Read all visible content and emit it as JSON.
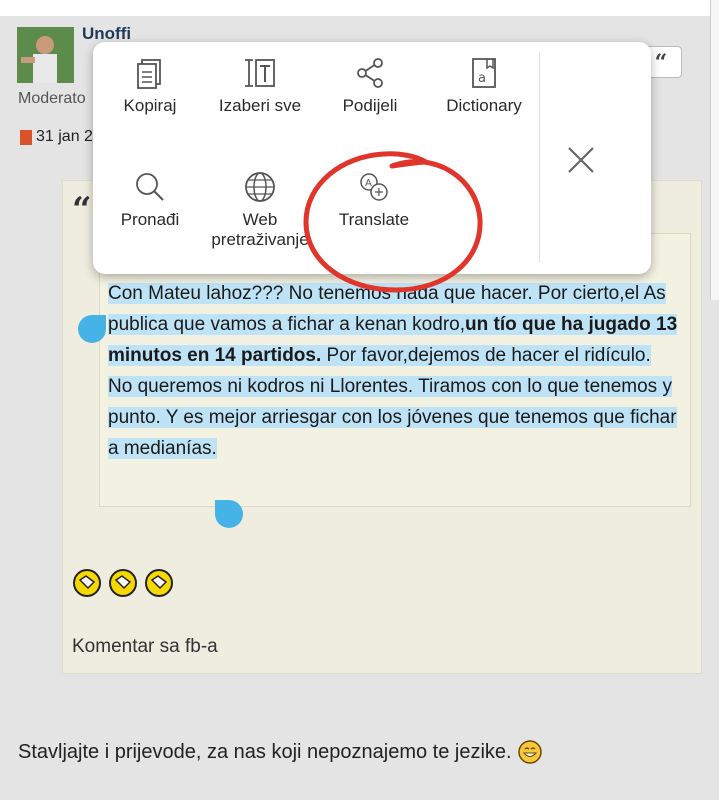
{
  "post": {
    "username": "Unoffi",
    "role": "Moderato",
    "date": "31 jan 2",
    "quote_mark": "“",
    "quote_text_1": "Con Mateu lahoz??? No tenemos nada que hacer. Por cierto,el As publica que vamos a fichar a kenan kodro,",
    "quote_text_bold": "un tío que ha jugado 13 minutos en 14 partidos.",
    "quote_text_2": " Por favor,dejemos de hacer el ridículo. No queremos ni kodros ni Llorentes. Tiramos con lo que tenemos y punto. Y es mejor arriesgar con los jóvenes que tenemos que fichar a medianías.",
    "comment_label": "Komentar sa fb-a",
    "quote_button_label": "“"
  },
  "reply": {
    "text": "Stavljajte i prijevode, za nas koji nepoznajemo te jezike."
  },
  "context_menu": {
    "items": [
      {
        "label": "Kopiraj",
        "icon": "copy-icon"
      },
      {
        "label": "Izaberi sve",
        "icon": "select-all-icon"
      },
      {
        "label": "Podijeli",
        "icon": "share-icon"
      },
      {
        "label": "Dictionary",
        "icon": "dictionary-icon"
      },
      {
        "label": "Pronađi",
        "icon": "search-icon"
      },
      {
        "label": "Web pretraživanje",
        "icon": "globe-icon"
      },
      {
        "label": "Translate",
        "icon": "translate-icon"
      }
    ],
    "close_icon": "close-icon"
  },
  "colors": {
    "selection": "#bfe3f6",
    "handle": "#45b3e6",
    "annotation_circle": "#e0352b",
    "post_background": "#efede0"
  }
}
